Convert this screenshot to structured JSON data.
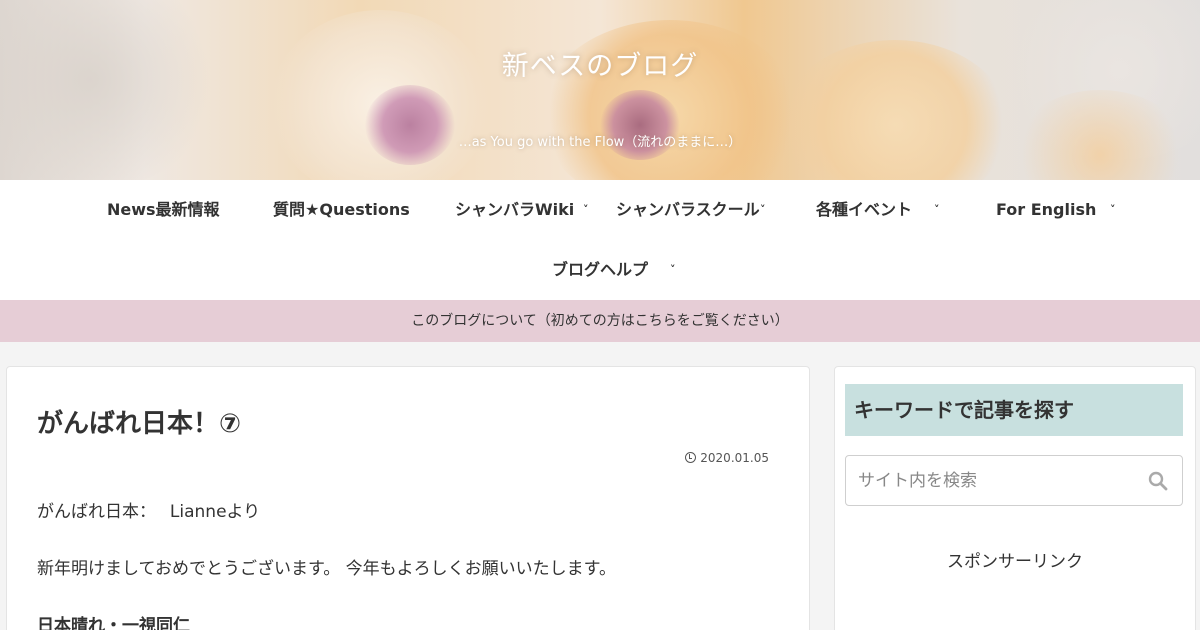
{
  "header": {
    "site_title": "新ベスのブログ",
    "tagline": "…as You go with the Flow（流れのままに…）"
  },
  "nav": {
    "items": [
      {
        "label": "News最新情報",
        "has_submenu": false
      },
      {
        "label": "質問★Questions",
        "has_submenu": false
      },
      {
        "label": "シャンバラWiki",
        "has_submenu": true
      },
      {
        "label": "シャンバラスクール",
        "has_submenu": true
      },
      {
        "label": "各種イベント",
        "has_submenu": true
      },
      {
        "label": "For English",
        "has_submenu": true
      },
      {
        "label": "ブログヘルプ",
        "has_submenu": true
      }
    ],
    "chevron": "˅"
  },
  "notice": {
    "text": "このブログについて（初めての方はこちらをご覧ください）"
  },
  "article": {
    "title": "がんばれ日本！⑦",
    "date": "2020.01.05",
    "paragraph1": "がんばれ日本：　 Lianneより",
    "paragraph2": "新年明けましておめでとうございます。 今年もよろしくお願いいたします。",
    "heading": "日本晴れ・一視同仁"
  },
  "sidebar": {
    "search_widget_title": "キーワードで記事を探す",
    "search_placeholder": "サイト内を検索",
    "sponsor_label": "スポンサーリンク"
  },
  "colors": {
    "nav_bg": "#ffffff",
    "notice_bg": "#e6cdd6",
    "widget_title_bg": "#c8e0df",
    "page_bg": "#f4f4f4"
  }
}
